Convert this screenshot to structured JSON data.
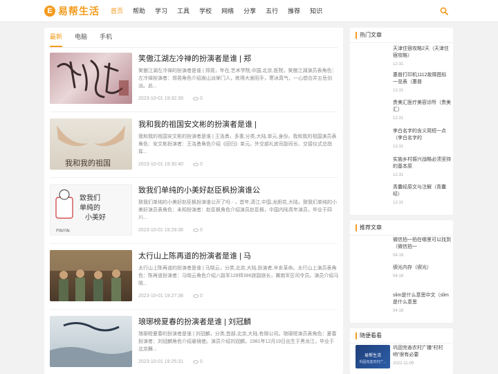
{
  "header": {
    "logo_letter": "E",
    "logo_text": "易帮生活",
    "nav": [
      "首页",
      "帮助",
      "学习",
      "工具",
      "学校",
      "网络",
      "分享",
      "五行",
      "推荐",
      "知识"
    ],
    "active_nav": 0
  },
  "colors": {
    "accent": "#f39a1c"
  },
  "main": {
    "tabs": [
      "最新",
      "电脑",
      "手机"
    ],
    "articles": [
      {
        "title": "笑傲江湖左冷禅的扮演者是谁 | 郑",
        "excerpt": "笑傲江湖左冷禅的扮演者是谁 | 郑晃，年在,艺术学院,中国,北京,医院，笑傲江湖演员表角色：左冷禅扮演者：郑晃角色介绍嵩山派掌门人，练得大嵩阳手，寒冰真气，一心想合并五岳剑派。此...",
        "date": "2023-10-01 19:32:39",
        "views": "0"
      },
      {
        "title": "我和我的祖国安文彬的扮演者是谁 |",
        "excerpt": "我和我的祖国安文彬的扮演者是谁 | 王洛勇，多重,分类,大陆,单元,身份。我和我的祖国演员表角色：安文彬扮演者：王洛勇角色介绍《回归》单元。外交部礼宾司副司长、交接仪式总指挥...",
        "date": "2023-10-01 19:30:40",
        "views": "0"
      },
      {
        "title": "致我们单纯的小美好赵臣枫扮演谁公",
        "excerpt": "致我们单纯的小美好赵臣枫扮演谁公开了吗 - ，首年,清江,中国,龙胆花,大陆，致我们单纯的小美好演员表角色：未知扮演者：赵臣枫角色介绍演员赵臣枫，中国内陆青年演员，毕业于四川...",
        "date": "2023-10-01 19:29:36",
        "views": "0"
      },
      {
        "title": "太行山上陈再道的扮演者是谁 | 马",
        "excerpt": "太行山上陈再道的扮演者是谁 | 马晓云，分类,北京,大陆,扮演者,辛亥革命。太行山上演员表角色：陈再道扮演者：马晓云角色介绍八路军128师386旅副旅长，冀南军区司令员。演员介绍马晓...",
        "date": "2023-10-01 19:27:36",
        "views": "0"
      },
      {
        "title": "琅琊榜夏春的扮演者是谁 | 刘冠麟",
        "excerpt": "琅琊榜夏春的扮演者是谁 | 刘冠麟，分类,首部,北京,大陆,有限公司。琅琊榜演员表角色：夏春扮演者：刘冠麟角色介绍悬镜使。演员介绍刘冠麟，1981年12月19日出生于黑龙江，毕业于北京舞...",
        "date": "2023-10-01 19:25:31",
        "views": "0"
      }
    ]
  },
  "sidebar": {
    "hot": {
      "title": "热门文章",
      "items": [
        {
          "title": "天津住宿攻略2天（天津住宿攻略）",
          "date": "12-31"
        },
        {
          "title": "惠普打印机1112故障图标一览表（惠普",
          "date": "12-31"
        },
        {
          "title": "贵美汇医疗美容诊所（贵美汇）",
          "date": "12-31"
        },
        {
          "title": "李白名字的含义简短一点（李白名字的",
          "date": "12-31"
        },
        {
          "title": "实施乡村振兴战略必须坚持的基本原",
          "date": "12-31"
        },
        {
          "title": "青囊经原文与注解（青囊经）",
          "date": "12-31"
        }
      ]
    },
    "recommend": {
      "title": "推荐文章",
      "items": [
        {
          "title": "微信拍一拍在哪里可以找到（微信拍一",
          "date": "04-16"
        },
        {
          "title": "锲光内存（锲光）",
          "date": "04-16"
        },
        {
          "title": "slim是什么意思中文（slim是什么意思",
          "date": "04-16"
        }
      ]
    },
    "random": {
      "title": "随便看看",
      "items": [
        {
          "title": "巩固完善农村广播“村村响”很有必要",
          "date": "2022-11-09",
          "thumb_text": "巩固完善农村广..."
        }
      ]
    }
  }
}
